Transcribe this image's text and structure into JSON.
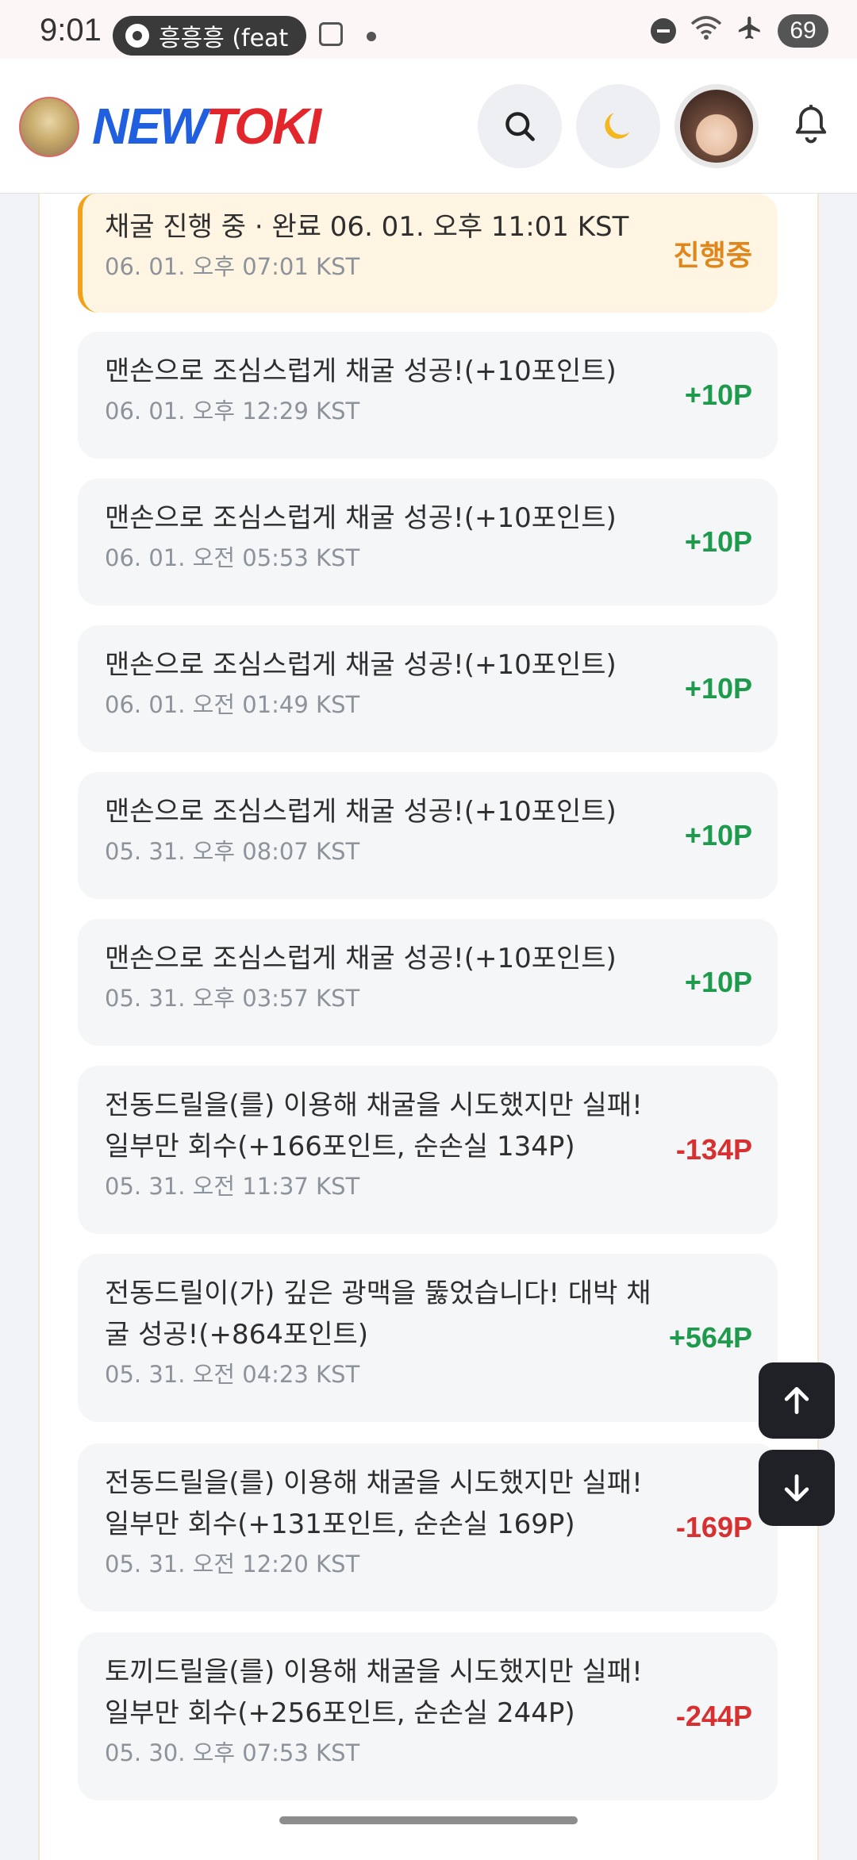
{
  "status_bar": {
    "time": "9:01",
    "media_label": "흥흥흥 (feat",
    "battery": "69"
  },
  "header": {
    "logo_new": "NEW",
    "logo_toki": "TOKI",
    "icons": [
      "search-icon",
      "moon-icon",
      "profile-avatar",
      "bell-icon"
    ]
  },
  "entries": [
    {
      "title": "채굴 진행 중 · 완료 06. 01. 오후 11:01 KST",
      "date": "06. 01. 오후 07:01 KST",
      "value": "진행중",
      "status": "in-progress"
    },
    {
      "title": "맨손으로 조심스럽게 채굴 성공!(+10포인트)",
      "date": "06. 01. 오후 12:29 KST",
      "value": "+10P",
      "status": "positive"
    },
    {
      "title": "맨손으로 조심스럽게 채굴 성공!(+10포인트)",
      "date": "06. 01. 오전 05:53 KST",
      "value": "+10P",
      "status": "positive"
    },
    {
      "title": "맨손으로 조심스럽게 채굴 성공!(+10포인트)",
      "date": "06. 01. 오전 01:49 KST",
      "value": "+10P",
      "status": "positive"
    },
    {
      "title": "맨손으로 조심스럽게 채굴 성공!(+10포인트)",
      "date": "05. 31. 오후 08:07 KST",
      "value": "+10P",
      "status": "positive"
    },
    {
      "title": "맨손으로 조심스럽게 채굴 성공!(+10포인트)",
      "date": "05. 31. 오후 03:57 KST",
      "value": "+10P",
      "status": "positive"
    },
    {
      "title": "전동드릴을(를) 이용해 채굴을 시도했지만 실패! 일부만 회수(+166포인트, 순손실 134P)",
      "date": "05. 31. 오전 11:37 KST",
      "value": "-134P",
      "status": "negative"
    },
    {
      "title": "전동드릴이(가) 깊은 광맥을 뚫었습니다! 대박 채굴 성공!(+864포인트)",
      "date": "05. 31. 오전 04:23 KST",
      "value": "+564P",
      "status": "positive"
    },
    {
      "title": "전동드릴을(를) 이용해 채굴을 시도했지만 실패! 일부만 회수(+131포인트, 순손실 169P)",
      "date": "05. 31. 오전 12:20 KST",
      "value": "-169P",
      "status": "negative"
    },
    {
      "title": "토끼드릴을(를) 이용해 채굴을 시도했지만 실패! 일부만 회수(+256포인트, 순손실 244P)",
      "date": "05. 30. 오후 07:53 KST",
      "value": "-244P",
      "status": "negative"
    }
  ],
  "colors": {
    "positive": "#1e9a4d",
    "negative": "#d63030",
    "in_progress": "#e0861a",
    "accent_border": "#f2a11a"
  }
}
